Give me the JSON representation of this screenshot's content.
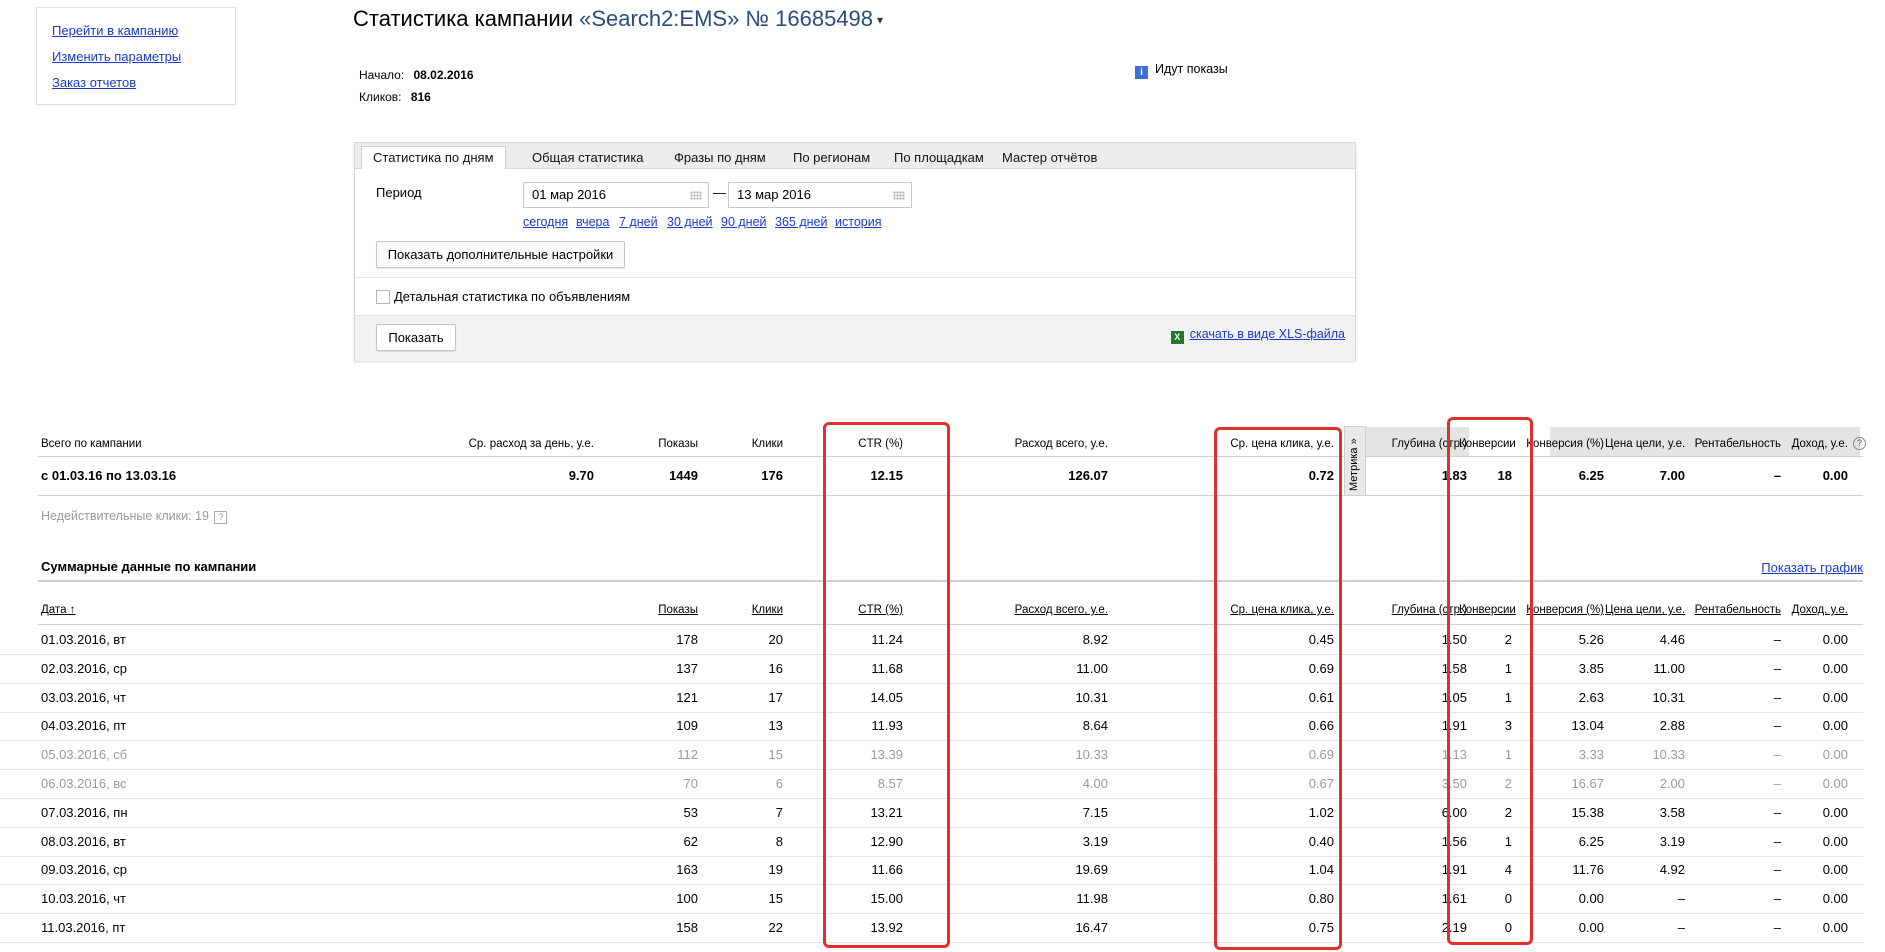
{
  "nav": {
    "links": [
      "Перейти в кампанию",
      "Изменить параметры",
      "Заказ отчетов"
    ]
  },
  "header": {
    "title_prefix": "Статистика кампании",
    "campaign": "«Search2:EMS» № 16685498",
    "arrow": "▾",
    "start_label": "Начало:",
    "start_value": "08.02.2016",
    "clicks_label": "Кликов:",
    "clicks_value": "816",
    "status": "Идут показы",
    "status_icon": "info-icon"
  },
  "tabs": [
    "Статистика по дням",
    "Общая статистика",
    "Фразы по дням",
    "По регионам",
    "По площадкам",
    "Мастер отчётов"
  ],
  "filter": {
    "period_label": "Период",
    "date_from": "01 мар 2016",
    "date_to": "13 мар 2016",
    "dash": "—",
    "quick": [
      "сегодня",
      "вчера",
      "7 дней",
      "30 дней",
      "90 дней",
      "365 дней",
      "история"
    ],
    "more_settings": "Показать дополнительные настройки",
    "detailed_label": "Детальная статистика по объявлениям",
    "show_button": "Показать",
    "xls_link": "скачать в виде XLS-файла"
  },
  "summary": {
    "headers": [
      "Всего по кампании",
      "Ср. расход за день, у.е.",
      "Показы",
      "Клики",
      "CTR (%)",
      "Расход всего, у.е.",
      "Ср. цена клика, у.е.",
      "Глубина (стр.)",
      "Конверсии",
      "Конверсия (%)",
      "Цена цели, у.е.",
      "Рентабельность",
      "Доход, у.е."
    ],
    "period": "с 01.03.16 по 13.03.16",
    "values": [
      "9.70",
      "1449",
      "176",
      "12.15",
      "126.07",
      "0.72",
      "1.83",
      "18",
      "6.25",
      "7.00",
      "–",
      "0.00"
    ],
    "metrika": "Метрика »",
    "help": "?",
    "invalid_clicks": "Недействительные клики: 19"
  },
  "daily": {
    "title": "Суммарные данные по кампании",
    "show_chart": "Показать график",
    "headers": [
      "Дата ↑",
      "Показы",
      "Клики",
      "CTR (%)",
      "Расход всего, у.е.",
      "Ср. цена клика, у.е.",
      "Глубина (стр.)",
      "Конверсии",
      "Конверсия (%)",
      "Цена цели, у.е.",
      "Рентабельность",
      "Доход, у.е."
    ],
    "rows": [
      [
        "01.03.2016, вт",
        "178",
        "20",
        "11.24",
        "8.92",
        "0.45",
        "1.50",
        "2",
        "5.26",
        "4.46",
        "–",
        "0.00"
      ],
      [
        "02.03.2016, ср",
        "137",
        "16",
        "11.68",
        "11.00",
        "0.69",
        "1.58",
        "1",
        "3.85",
        "11.00",
        "–",
        "0.00"
      ],
      [
        "03.03.2016, чт",
        "121",
        "17",
        "14.05",
        "10.31",
        "0.61",
        "1.05",
        "1",
        "2.63",
        "10.31",
        "–",
        "0.00"
      ],
      [
        "04.03.2016, пт",
        "109",
        "13",
        "11.93",
        "8.64",
        "0.66",
        "1.91",
        "3",
        "13.04",
        "2.88",
        "–",
        "0.00"
      ],
      [
        "05.03.2016, сб",
        "112",
        "15",
        "13.39",
        "10.33",
        "0.69",
        "1.13",
        "1",
        "3.33",
        "10.33",
        "–",
        "0.00"
      ],
      [
        "06.03.2016, вс",
        "70",
        "6",
        "8.57",
        "4.00",
        "0.67",
        "3.50",
        "2",
        "16.67",
        "2.00",
        "–",
        "0.00"
      ],
      [
        "07.03.2016, пн",
        "53",
        "7",
        "13.21",
        "7.15",
        "1.02",
        "6.00",
        "2",
        "15.38",
        "3.58",
        "–",
        "0.00"
      ],
      [
        "08.03.2016, вт",
        "62",
        "8",
        "12.90",
        "3.19",
        "0.40",
        "1.56",
        "1",
        "6.25",
        "3.19",
        "–",
        "0.00"
      ],
      [
        "09.03.2016, ср",
        "163",
        "19",
        "11.66",
        "19.69",
        "1.04",
        "1.91",
        "4",
        "11.76",
        "4.92",
        "–",
        "0.00"
      ],
      [
        "10.03.2016, чт",
        "100",
        "15",
        "15.00",
        "11.98",
        "0.80",
        "1.61",
        "0",
        "0.00",
        "–",
        "–",
        "0.00"
      ],
      [
        "11.03.2016, пт",
        "158",
        "22",
        "13.92",
        "16.47",
        "0.75",
        "2.19",
        "0",
        "0.00",
        "–",
        "–",
        "0.00"
      ]
    ],
    "weekend_rows": [
      4,
      5
    ]
  }
}
